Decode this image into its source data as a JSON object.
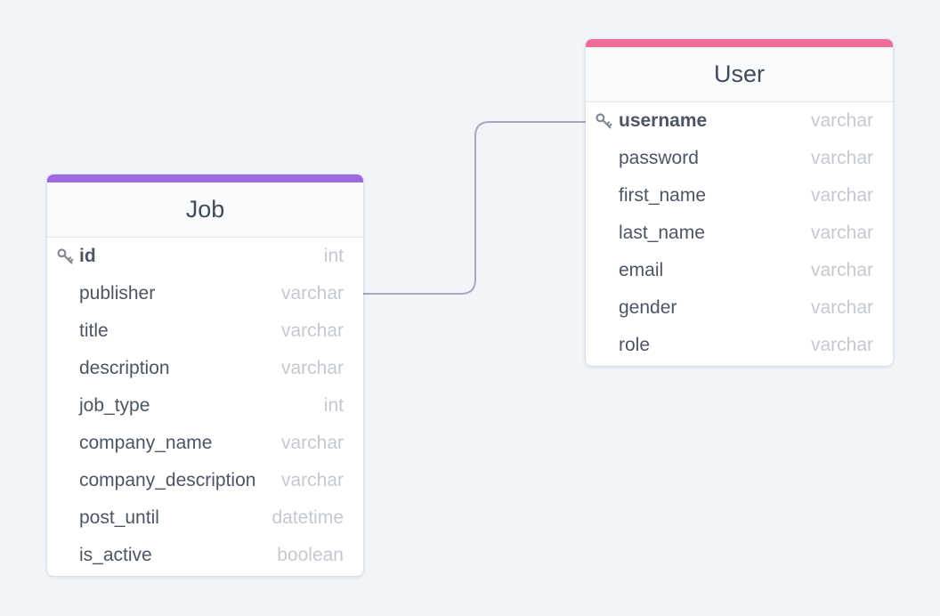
{
  "colors": {
    "background": "#f1f5f9",
    "job_accent": "#9c69e0",
    "user_accent": "#f06b96",
    "connector": "#a3aac0",
    "key_icon": "#858a95"
  },
  "tables": {
    "job": {
      "name": "Job",
      "columns": [
        {
          "name": "id",
          "type": "int",
          "primary_key": true
        },
        {
          "name": "publisher",
          "type": "varchar",
          "primary_key": false
        },
        {
          "name": "title",
          "type": "varchar",
          "primary_key": false
        },
        {
          "name": "description",
          "type": "varchar",
          "primary_key": false
        },
        {
          "name": "job_type",
          "type": "int",
          "primary_key": false
        },
        {
          "name": "company_name",
          "type": "varchar",
          "primary_key": false
        },
        {
          "name": "company_description",
          "type": "varchar",
          "primary_key": false
        },
        {
          "name": "post_until",
          "type": "datetime",
          "primary_key": false
        },
        {
          "name": "is_active",
          "type": "boolean",
          "primary_key": false
        }
      ]
    },
    "user": {
      "name": "User",
      "columns": [
        {
          "name": "username",
          "type": "varchar",
          "primary_key": true
        },
        {
          "name": "password",
          "type": "varchar",
          "primary_key": false
        },
        {
          "name": "first_name",
          "type": "varchar",
          "primary_key": false
        },
        {
          "name": "last_name",
          "type": "varchar",
          "primary_key": false
        },
        {
          "name": "email",
          "type": "varchar",
          "primary_key": false
        },
        {
          "name": "gender",
          "type": "varchar",
          "primary_key": false
        },
        {
          "name": "role",
          "type": "varchar",
          "primary_key": false
        }
      ]
    }
  },
  "relations": [
    {
      "from_table": "job",
      "from_column": "publisher",
      "to_table": "user",
      "to_column": "username"
    }
  ]
}
